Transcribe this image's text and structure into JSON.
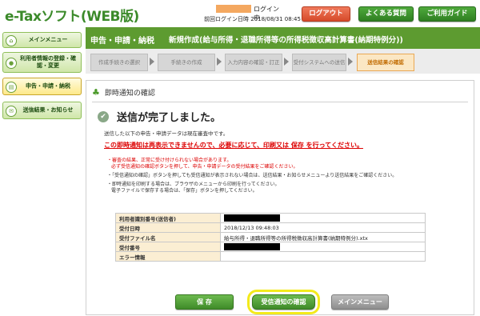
{
  "header": {
    "logo": "e-Taxソフト(WEB版)",
    "login_status": "ログイン中",
    "last_login": "前回ログイン日時 2018/08/31 08:45",
    "logout_label": "ログアウト",
    "faq_label": "よくある質問",
    "guide_label": "ご利用ガイド"
  },
  "sidebar": {
    "items": [
      {
        "label": "メインメニュー"
      },
      {
        "label": "利用者情報の登録・確認・変更"
      },
      {
        "label": "申告・申請・納税"
      },
      {
        "label": "送信結果・お知らせ"
      }
    ]
  },
  "content_bar": {
    "section": "申告・申請・納税",
    "subtitle": "新規作成(給与所得・退職所得等の所得税徴収高計算書(納期特例分))"
  },
  "steps": [
    {
      "label": "作成手続きの選択"
    },
    {
      "label": "手続きの作成"
    },
    {
      "label": "入力内容の確認・訂正"
    },
    {
      "label": "受付システムへの送信"
    },
    {
      "label": "送信結果の確認"
    }
  ],
  "panel": {
    "title": "即時通知の確認",
    "done_message": "送信が完了しました。",
    "line1": "送信した以下の申告・申請データは現在審査中です。",
    "line2": "この即時通知は再表示できませんので、必要に応じて、印刷又は 保存 を行ってください。",
    "bullet1a": "審査の結果、正常に受け付けられない場合があります。",
    "bullet1b": "必ず受信通知の確認ボタンを押して、申告・申請データの受付結果をご確認ください。",
    "bullet2": "「受信通知の確認」ボタンを押しても受信通知が表示されない場合は、送信結果・お知らせメニューより送信結果をご確認ください。",
    "bullet3a": "即時通知を印刷する場合は、ブラウザのメニューから印刷を行ってください。",
    "bullet3b": "電子ファイルで保存する場合は、「保存」ボタンを押してください。"
  },
  "table": {
    "rows": [
      {
        "label": "利用者識別番号(送信者)",
        "value": ""
      },
      {
        "label": "受付日時",
        "value": "2018/12/13 09:48:03"
      },
      {
        "label": "受付ファイル名",
        "value": "給与所得・退職所得等の所得税徴収高計算書(納期特例分).xtx"
      },
      {
        "label": "受付番号",
        "value": ""
      },
      {
        "label": "エラー情報",
        "value": ""
      }
    ]
  },
  "buttons": {
    "save": "保 存",
    "confirm": "受信通知の確認",
    "menu": "メインメニュー"
  },
  "colors": {
    "brand_green": "#5d9b30",
    "alert_red": "#dd0000",
    "highlight_yellow": "#f3ea1c",
    "logout_orange": "#e0603e"
  }
}
